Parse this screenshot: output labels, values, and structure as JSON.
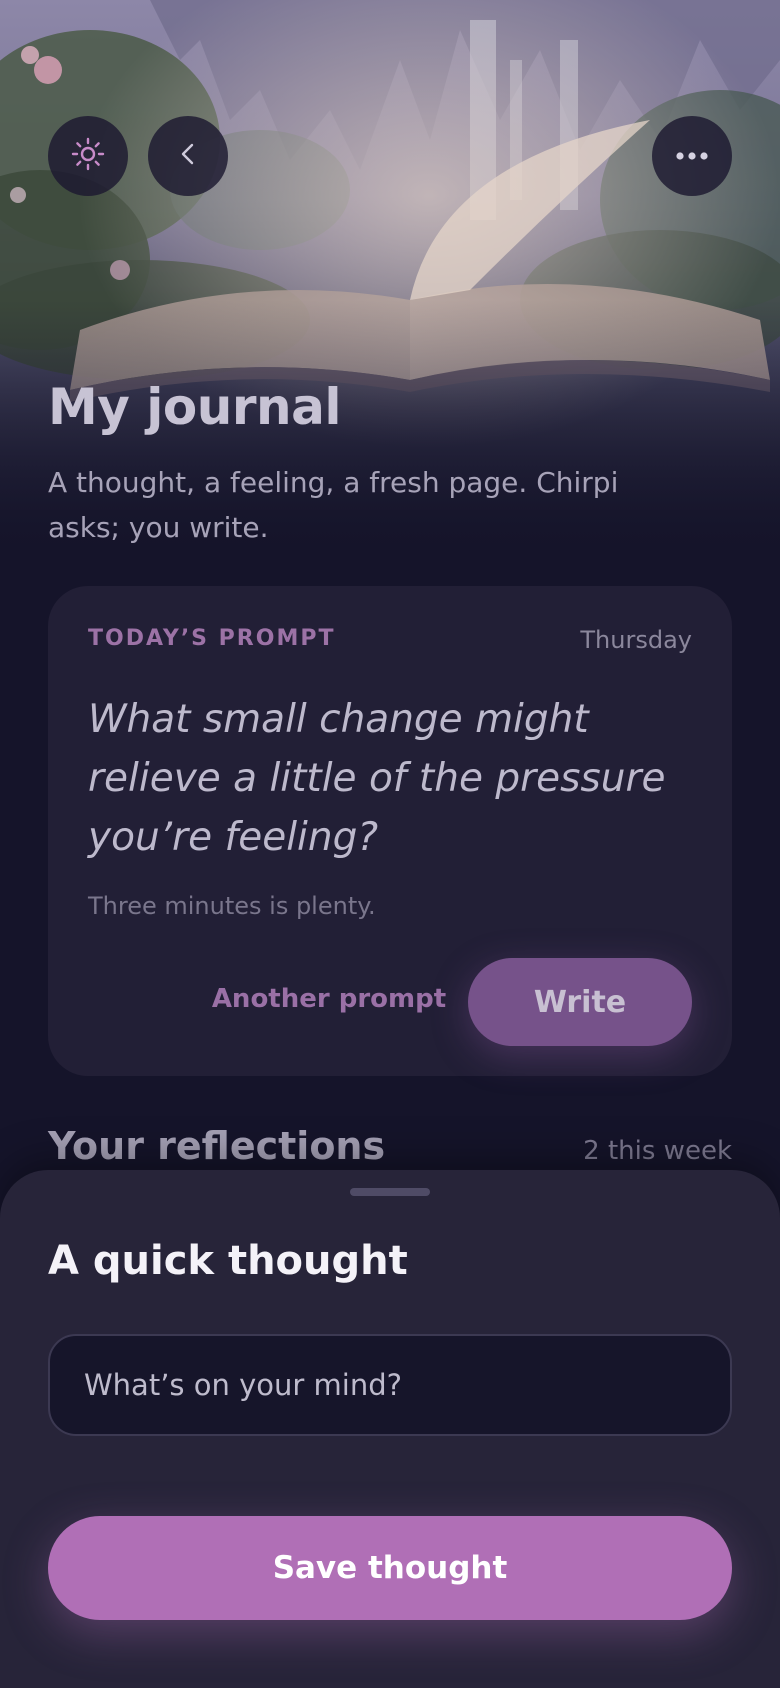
{
  "header": {
    "title": "My journal",
    "subtitle": "A thought, a feeling, a fresh page. Chirpi asks; you write."
  },
  "top_bar": {
    "theme_icon": "sun-icon",
    "back_icon": "chevron-left-icon",
    "more_icon": "ellipsis-icon"
  },
  "prompt_card": {
    "kicker": "TODAY’S PROMPT",
    "day": "Thursday",
    "question": "What small change might relieve a little of the pressure you’re feeling?",
    "hint": "Three minutes is plenty.",
    "another_label": "Another prompt",
    "write_label": "Write"
  },
  "reflections": {
    "title": "Your reflections",
    "count": "2 this week"
  },
  "sheet": {
    "title": "A quick thought",
    "input_placeholder": "What’s on your mind?",
    "input_value": "",
    "save_label": "Save thought"
  },
  "colors": {
    "background": "#15142a",
    "card": "#221f36",
    "sheet": "#272439",
    "accent": "#b06fb6",
    "accent_muted": "#76528a"
  }
}
